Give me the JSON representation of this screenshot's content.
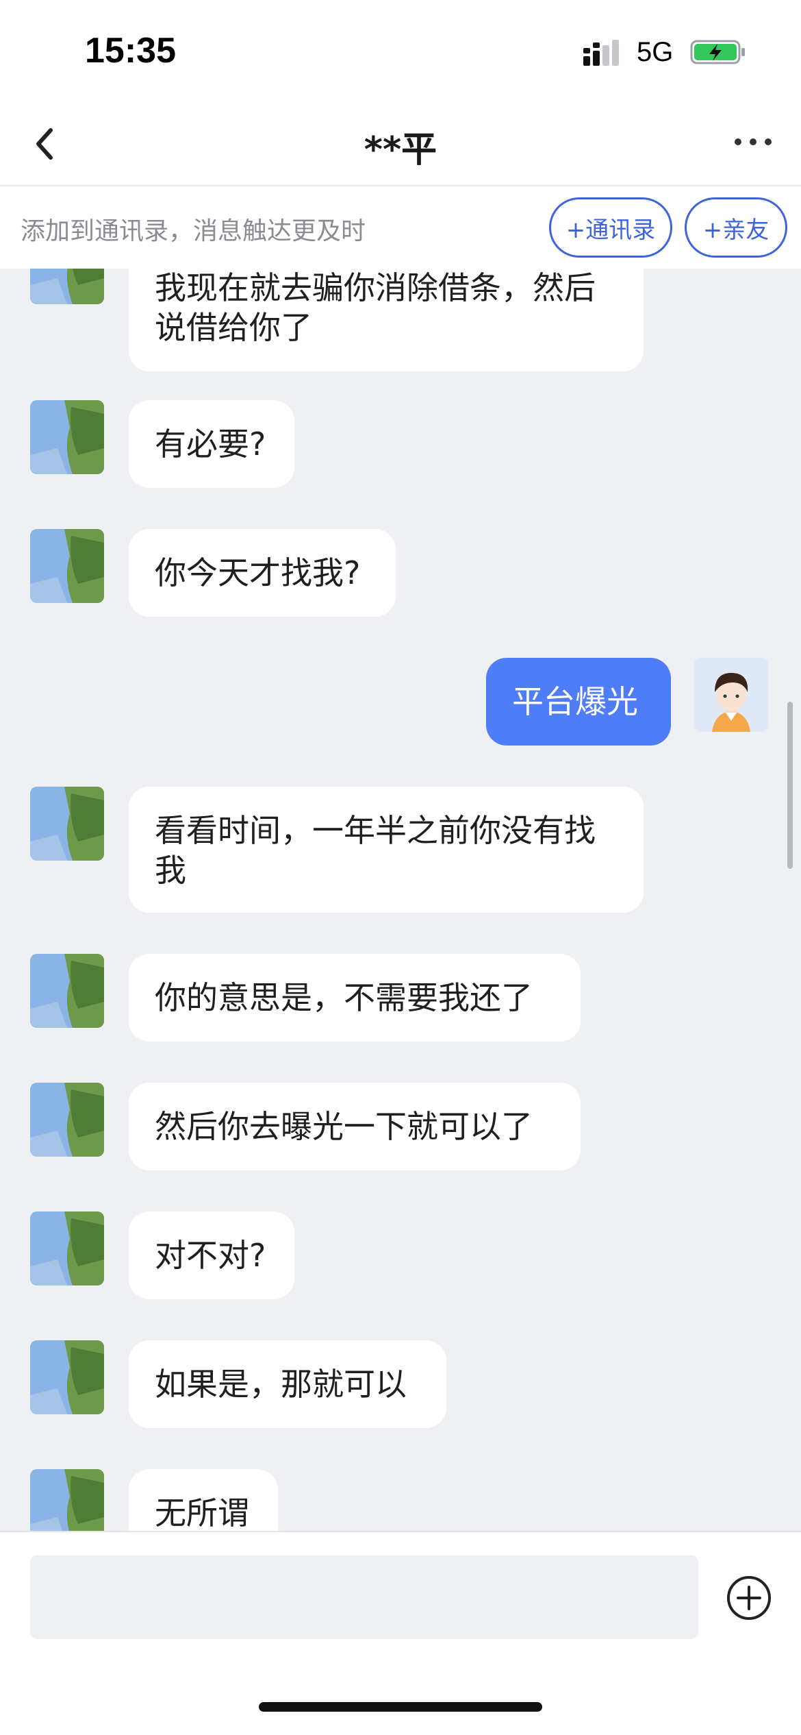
{
  "status_bar": {
    "time": "15:35",
    "network": "5G",
    "icons": [
      "signal-icon",
      "battery-charging-icon"
    ]
  },
  "header": {
    "title": "**平",
    "back_icon": "chevron-left-icon",
    "more_icon": "more-horizontal-icon"
  },
  "banner": {
    "text": "添加到通讯录，消息触达更及时",
    "contacts_button": "+通讯录",
    "family_button": "+亲友"
  },
  "messages": [
    {
      "side": "in",
      "text": "我现在就去骗你消除借条，然后说借给你了"
    },
    {
      "side": "in",
      "text": "有必要?"
    },
    {
      "side": "in",
      "text": "你今天才找我?"
    },
    {
      "side": "out",
      "text": "平台爆光"
    },
    {
      "side": "in",
      "text": "看看时间，一年半之前你没有找我"
    },
    {
      "side": "in",
      "text": "你的意思是，不需要我还了"
    },
    {
      "side": "in",
      "text": "然后你去曝光一下就可以了"
    },
    {
      "side": "in",
      "text": "对不对?"
    },
    {
      "side": "in",
      "text": "如果是，那就可以"
    },
    {
      "side": "in",
      "text": "无所谓"
    }
  ],
  "input": {
    "placeholder": "",
    "plus_icon": "plus-circle-icon"
  },
  "colors": {
    "accent": "#3d63dd",
    "outgoing_bubble": "#4f7cf7",
    "chat_background": "#eff0f4"
  }
}
